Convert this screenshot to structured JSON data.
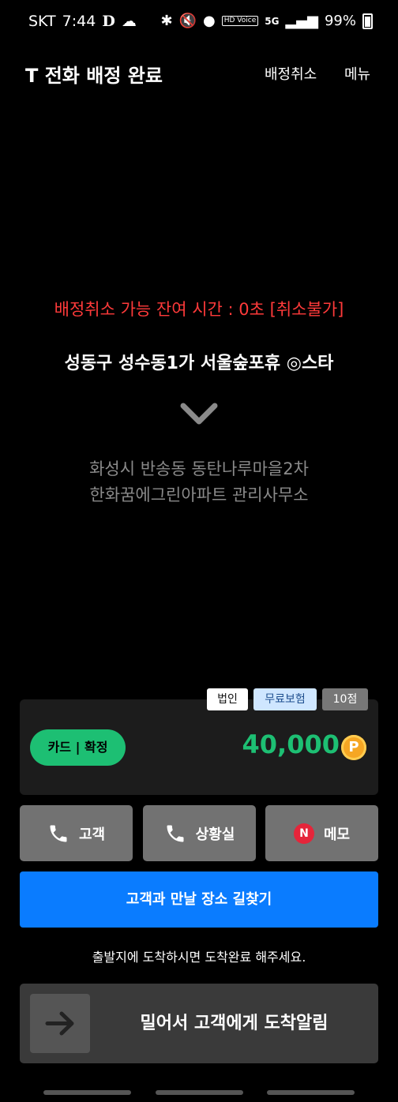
{
  "status_bar": {
    "carrier": "SKT",
    "time": "7:44",
    "extra_left": "D",
    "hd_voice": "HD Voice",
    "network": "5G",
    "battery": "99%"
  },
  "header": {
    "title": "T 전화 배정 완료",
    "cancel_label": "배정취소",
    "menu_label": "메뉴"
  },
  "trip": {
    "cancel_notice": "배정취소 가능 잔여 시간 : 0초 [취소불가]",
    "origin": "성동구 성수동1가 서울숲포휴 ◎스타",
    "destination_line1": "화성시 반송동 동탄나루마을2차",
    "destination_line2": "한화꿈에그린아파트 관리사무소"
  },
  "fare": {
    "badges": [
      "법인",
      "무료보험",
      "10점"
    ],
    "payment": "카드 | 확정",
    "amount": "40,000",
    "coin_symbol": "P"
  },
  "actions": {
    "customer": "고객",
    "control_room": "상황실",
    "memo": "메모",
    "memo_badge": "N"
  },
  "navigate": {
    "label": "고객과 만날 장소 길찾기"
  },
  "hint": "출발지에 도착하시면 도착완료 해주세요.",
  "slider": {
    "label": "밀어서 고객에게 도착알림"
  },
  "colors": {
    "accent_green": "#1dbf73",
    "accent_blue": "#0a7cff",
    "warning_red": "#ff3a3a"
  }
}
